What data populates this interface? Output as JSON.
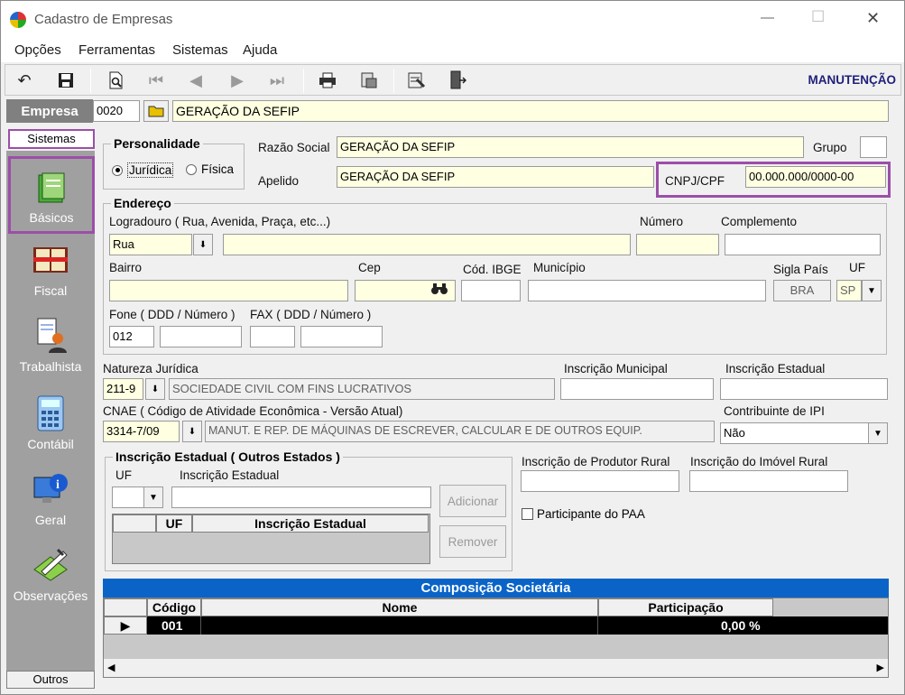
{
  "window": {
    "title": "Cadastro de Empresas",
    "minimize": "—",
    "maximize": "☐",
    "close": "✕"
  },
  "menu": [
    "Opções",
    "Ferramentas",
    "Sistemas",
    "Ajuda"
  ],
  "toolbar": {
    "mode_label": "MANUTENÇÃO"
  },
  "empresa": {
    "label": "Empresa",
    "code": "0020",
    "name": "GERAÇÃO DA SEFIP"
  },
  "sidebar": {
    "header": "Sistemas",
    "items": [
      "Básicos",
      "Fiscal",
      "Trabalhista",
      "Contábil",
      "Geral",
      "Observações"
    ],
    "footer": "Outros"
  },
  "personalidade": {
    "title": "Personalidade",
    "opt1": "Jurídica",
    "opt2": "Física"
  },
  "razao_social": {
    "label": "Razão Social",
    "value": "GERAÇÃO DA SEFIP"
  },
  "grupo": {
    "label": "Grupo",
    "value": ""
  },
  "apelido": {
    "label": "Apelido",
    "value": "GERAÇÃO DA SEFIP"
  },
  "cnpj": {
    "label": "CNPJ/CPF",
    "value": "00.000.000/0000-00"
  },
  "endereco": {
    "title": "Endereço",
    "logradouro_label": "Logradouro ( Rua, Avenida, Praça, etc...)",
    "tipo": "Rua",
    "logradouro": "",
    "numero_label": "Número",
    "complemento_label": "Complemento",
    "bairro_label": "Bairro",
    "cep_label": "Cep",
    "ibge_label": "Cód. IBGE",
    "municipio_label": "Município",
    "sigla_label": "Sigla País",
    "sigla": "BRA",
    "uf_label": "UF",
    "uf": "SP",
    "fone_label": "Fone ( DDD / Número )",
    "fone_ddd": "012",
    "fax_label": "FAX ( DDD / Número )"
  },
  "natureza": {
    "label": "Natureza Jurídica",
    "code": "211-9",
    "desc": "SOCIEDADE CIVIL COM FINS LUCRATIVOS"
  },
  "insc_municipal": {
    "label": "Inscrição Municipal"
  },
  "insc_estadual": {
    "label": "Inscrição Estadual"
  },
  "cnae": {
    "label": "CNAE ( Código de Atividade Econômica - Versão Atual)",
    "code": "3314-7/09",
    "desc": "MANUT. E REP. DE MÁQUINAS DE ESCREVER, CALCULAR E DE OUTROS EQUIP."
  },
  "ipi": {
    "label": "Contribuinte de IPI",
    "value": "Não"
  },
  "outros_estados": {
    "title": "Inscrição Estadual ( Outros Estados )",
    "uf_label": "UF",
    "ie_label": "Inscrição Estadual",
    "col_uf": "UF",
    "col_ie": "Inscrição Estadual",
    "add": "Adicionar",
    "remove": "Remover"
  },
  "produtor_rural": {
    "label": "Inscrição de Produtor Rural"
  },
  "imovel_rural": {
    "label": "Inscrição do Imóvel Rural"
  },
  "paa": {
    "label": "Participante do PAA"
  },
  "societaria": {
    "title": "Composição Societária",
    "col_codigo": "Código",
    "col_nome": "Nome",
    "col_part": "Participação",
    "row": {
      "codigo": "001",
      "nome": "",
      "part": "0,00 %"
    }
  },
  "colors": {
    "accent_purple": "#9b4fa8",
    "header_blue": "#0a64c8",
    "title_navy": "#1f1f7a"
  }
}
